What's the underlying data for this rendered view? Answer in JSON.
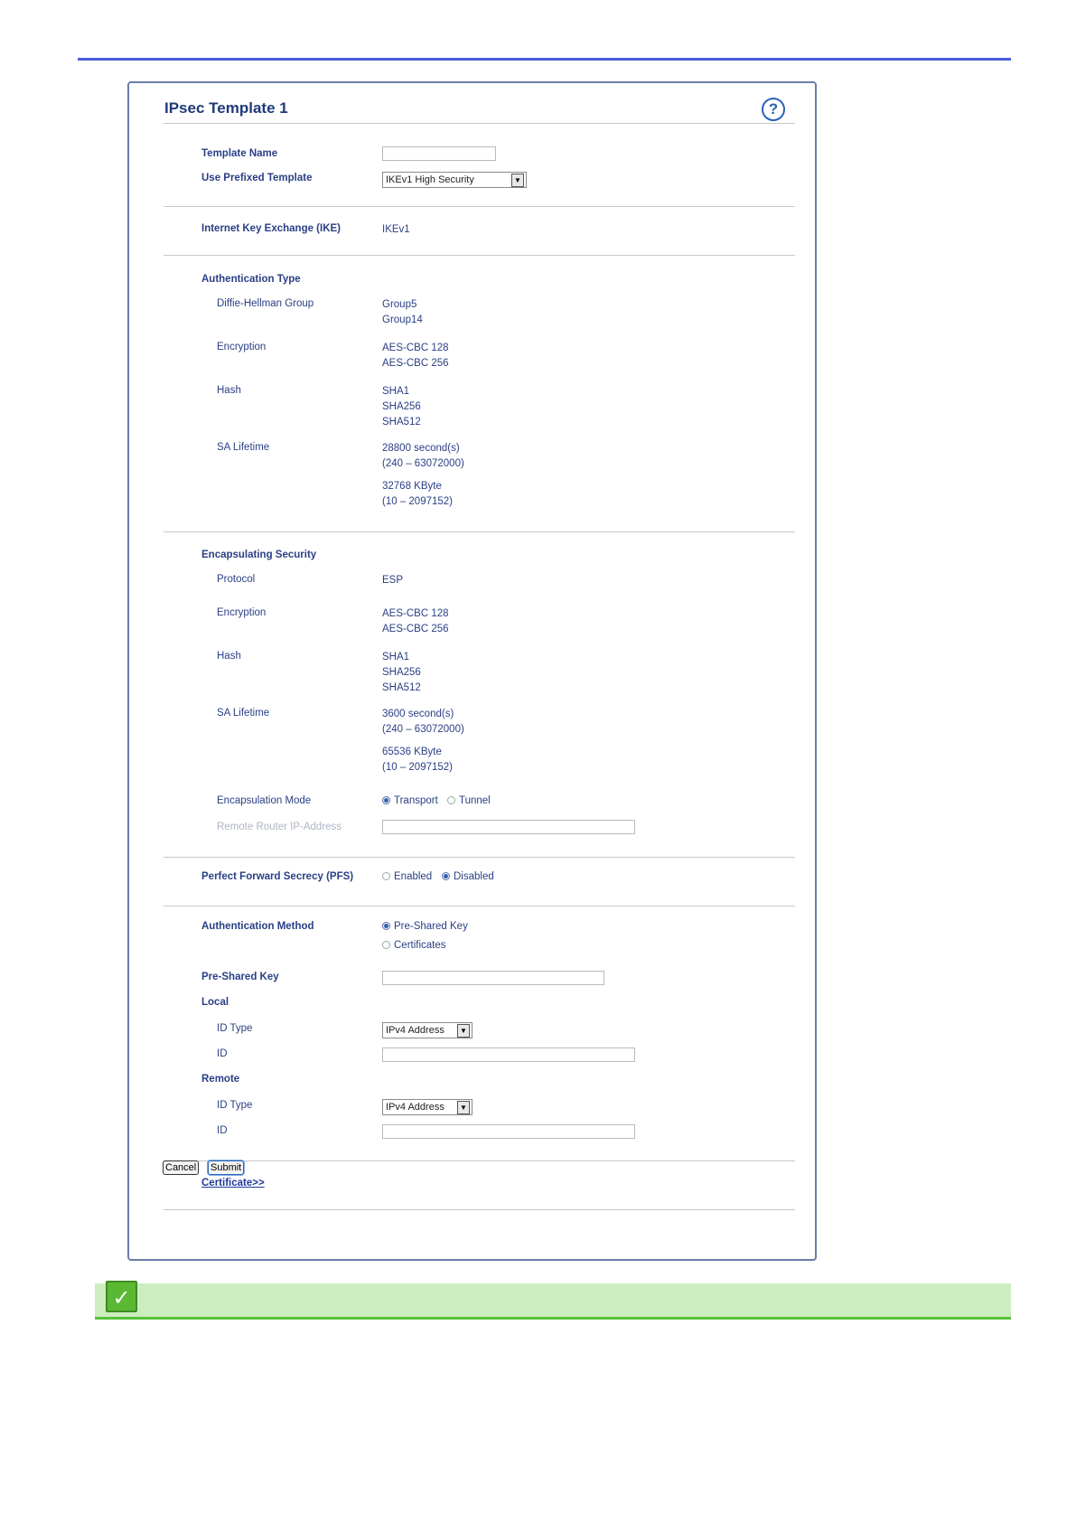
{
  "title": "IPsec Template 1",
  "help_icon": "?",
  "template_name": {
    "label": "Template Name",
    "value": ""
  },
  "prefixed_template": {
    "label": "Use Prefixed Template",
    "value": "IKEv1 High Security"
  },
  "ike": {
    "label": "Internet Key Exchange (IKE)",
    "value": "IKEv1"
  },
  "auth_type": {
    "heading": "Authentication Type",
    "dh_label": "Diffie-Hellman Group",
    "dh_1": "Group5",
    "dh_2": "Group14",
    "enc_label": "Encryption",
    "enc_1": "AES-CBC 128",
    "enc_2": "AES-CBC 256",
    "hash_label": "Hash",
    "hash_1": "SHA1",
    "hash_2": "SHA256",
    "hash_3": "SHA512",
    "sa_label": "SA Lifetime",
    "sa_1": "28800 second(s)",
    "sa_2": "(240 – 63072000)",
    "sa_3": "32768 KByte",
    "sa_4": "(10 – 2097152)"
  },
  "encap_security": {
    "heading": "Encapsulating Security",
    "protocol_label": "Protocol",
    "protocol": "ESP",
    "enc_label": "Encryption",
    "enc_1": "AES-CBC 128",
    "enc_2": "AES-CBC 256",
    "hash_label": "Hash",
    "hash_1": "SHA1",
    "hash_2": "SHA256",
    "hash_3": "SHA512",
    "sa_label": "SA Lifetime",
    "sa_1": "3600 second(s)",
    "sa_2": "(240 – 63072000)",
    "sa_3": "65536 KByte",
    "sa_4": "(10 – 2097152)",
    "mode_label": "Encapsulation Mode",
    "mode_transport": "Transport",
    "mode_tunnel": "Tunnel",
    "remote_label": "Remote Router IP-Address",
    "remote_value": ""
  },
  "pfs": {
    "label": "Perfect Forward Secrecy (PFS)",
    "enabled": "Enabled",
    "disabled": "Disabled"
  },
  "auth_method": {
    "label": "Authentication Method",
    "psk": "Pre-Shared Key",
    "certs": "Certificates"
  },
  "psk": {
    "label": "Pre-Shared Key",
    "value": ""
  },
  "local": {
    "heading": "Local",
    "id_type_label": "ID Type",
    "id_type": "IPv4 Address",
    "id_label": "ID",
    "id_value": ""
  },
  "remote": {
    "heading": "Remote",
    "id_type_label": "ID Type",
    "id_type": "IPv4 Address",
    "id_label": "ID",
    "id_value": ""
  },
  "certificate_link": "Certificate>>",
  "buttons": {
    "cancel": "Cancel",
    "submit": "Submit"
  },
  "note_icon": "✓",
  "colors": {
    "accent": "#4a5fd6",
    "note_bg": "#ccedc0",
    "note_border": "#55c23a"
  }
}
